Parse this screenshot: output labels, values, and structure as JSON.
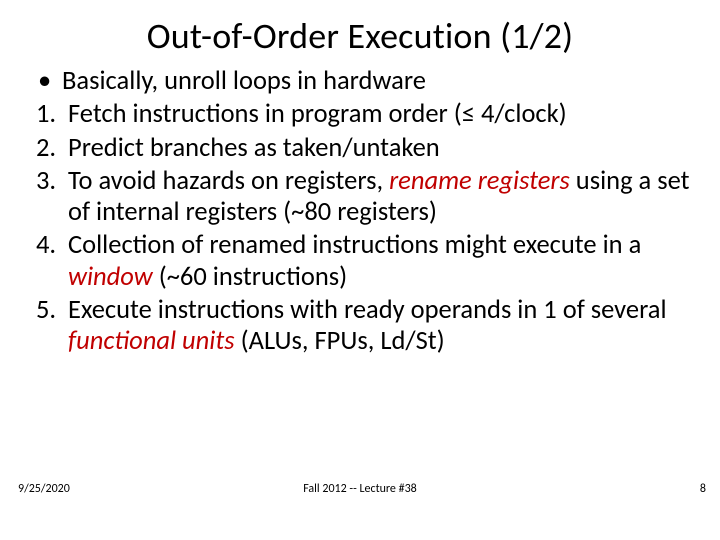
{
  "title": "Out-of-Order Execution (1/2)",
  "bullet": {
    "marker": "•",
    "text": "Basically, unroll loops in hardware"
  },
  "items": [
    {
      "marker": "1.",
      "pre": "Fetch instructions in program order (≤ 4/clock)"
    },
    {
      "marker": "2.",
      "pre": "Predict branches as taken/untaken"
    },
    {
      "marker": "3.",
      "pre": "To avoid hazards on registers, ",
      "emph": "rename registers",
      "post": " using a set of internal registers (~80 registers)"
    },
    {
      "marker": "4.",
      "pre": "Collection of renamed  instructions might execute in a ",
      "emph": "window",
      "post": " (~60 instructions)"
    },
    {
      "marker": "5.",
      "pre": "Execute instructions with ready operands in 1 of several ",
      "emph": "functional units",
      "post": " (ALUs, FPUs, Ld/St)"
    }
  ],
  "footer": {
    "date": "9/25/2020",
    "center": "Fall 2012 -- Lecture #38",
    "page": "8"
  }
}
